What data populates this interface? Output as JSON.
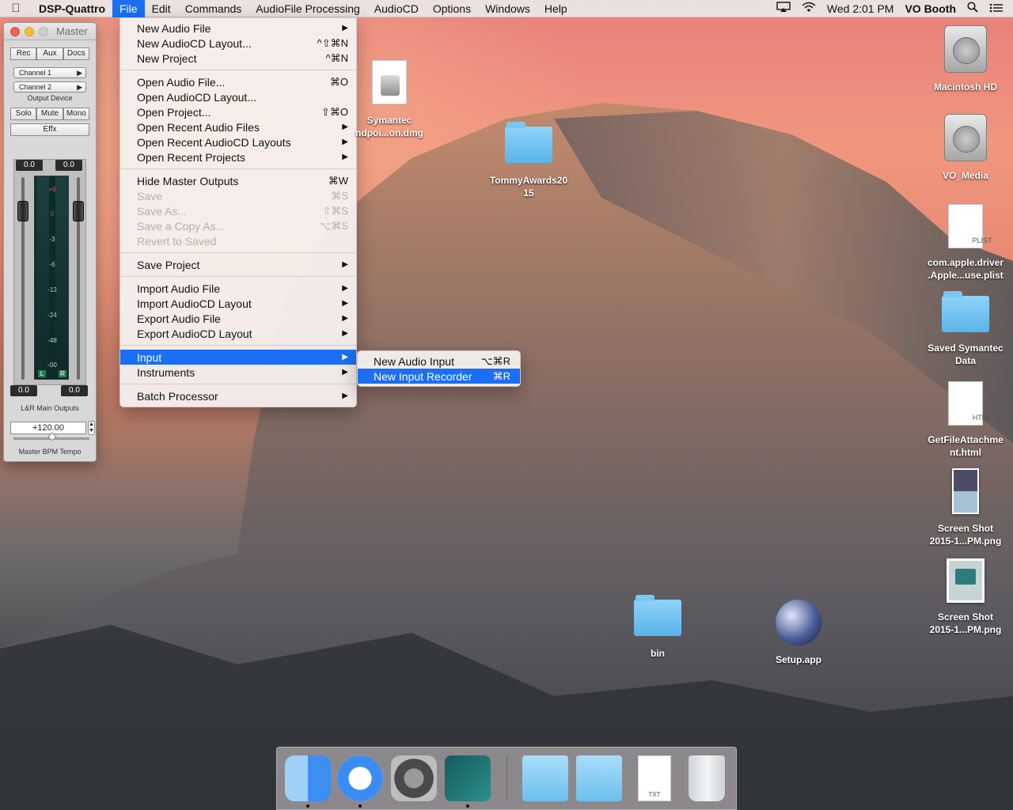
{
  "menubar": {
    "apple": "",
    "app_name": "DSP-Quattro",
    "menus": [
      "File",
      "Edit",
      "Commands",
      "AudioFile Processing",
      "AudioCD",
      "Options",
      "Windows",
      "Help"
    ],
    "clock": "Wed 2:01 PM",
    "user": "VO Booth"
  },
  "master_panel": {
    "title": "Master",
    "tabs": [
      "Rec",
      "Aux",
      "Docs"
    ],
    "channel1": "Channel  1",
    "channel2": "Channel  2",
    "output_device": "Output Device",
    "buttons": [
      "Solo",
      "Mute",
      "Mono"
    ],
    "effx": "Effx",
    "top_left_readout": "0.0",
    "top_right_readout": "0.0",
    "bottom_left_readout": "0.0",
    "bottom_right_readout": "0.0",
    "scale_ticks": [
      "+6",
      "0",
      "-3",
      "-6",
      "-12",
      "-24",
      "-48",
      "-00"
    ],
    "left_label": "L",
    "right_label": "R",
    "outputs_label": "L&R Main Outputs",
    "bpm_value": "+120.00",
    "bpm_label": "Master BPM Tempo"
  },
  "file_menu": {
    "groups": [
      [
        {
          "label": "New Audio File",
          "shortcut": "",
          "submenu": true,
          "disabled": false
        },
        {
          "label": "New AudioCD Layout...",
          "shortcut": "^⇧⌘N",
          "submenu": false,
          "disabled": false
        },
        {
          "label": "New Project",
          "shortcut": "^⌘N",
          "submenu": false,
          "disabled": false
        }
      ],
      [
        {
          "label": "Open Audio File...",
          "shortcut": "⌘O",
          "submenu": false,
          "disabled": false
        },
        {
          "label": "Open AudioCD Layout...",
          "shortcut": "",
          "submenu": false,
          "disabled": false
        },
        {
          "label": "Open Project...",
          "shortcut": "⇧⌘O",
          "submenu": false,
          "disabled": false
        },
        {
          "label": "Open Recent Audio Files",
          "shortcut": "",
          "submenu": true,
          "disabled": false
        },
        {
          "label": "Open Recent AudioCD Layouts",
          "shortcut": "",
          "submenu": true,
          "disabled": false
        },
        {
          "label": "Open Recent Projects",
          "shortcut": "",
          "submenu": true,
          "disabled": false
        }
      ],
      [
        {
          "label": "Hide Master Outputs",
          "shortcut": "⌘W",
          "submenu": false,
          "disabled": false
        },
        {
          "label": "Save",
          "shortcut": "⌘S",
          "submenu": false,
          "disabled": true
        },
        {
          "label": "Save As...",
          "shortcut": "⇧⌘S",
          "submenu": false,
          "disabled": true
        },
        {
          "label": "Save a Copy As...",
          "shortcut": "⌥⌘S",
          "submenu": false,
          "disabled": true
        },
        {
          "label": "Revert to Saved",
          "shortcut": "",
          "submenu": false,
          "disabled": true
        }
      ],
      [
        {
          "label": "Save Project",
          "shortcut": "",
          "submenu": true,
          "disabled": false
        }
      ],
      [
        {
          "label": "Import Audio File",
          "shortcut": "",
          "submenu": true,
          "disabled": false
        },
        {
          "label": "Import AudioCD Layout",
          "shortcut": "",
          "submenu": true,
          "disabled": false
        },
        {
          "label": "Export Audio File",
          "shortcut": "",
          "submenu": true,
          "disabled": false
        },
        {
          "label": "Export AudioCD Layout",
          "shortcut": "",
          "submenu": true,
          "disabled": false
        }
      ],
      [
        {
          "label": "Input",
          "shortcut": "",
          "submenu": true,
          "disabled": false,
          "highlighted": true
        },
        {
          "label": "Instruments",
          "shortcut": "",
          "submenu": true,
          "disabled": false
        }
      ],
      [
        {
          "label": "Batch Processor",
          "shortcut": "",
          "submenu": true,
          "disabled": false
        }
      ]
    ]
  },
  "input_submenu": [
    {
      "label": "New Audio Input",
      "shortcut": "⌥⌘R",
      "highlighted": false
    },
    {
      "label": "New Input Recorder",
      "shortcut": "⌘R",
      "highlighted": true
    }
  ],
  "desktop_icons": {
    "macintosh_hd": "Macintosh HD",
    "vo_media": "VO_Media",
    "plist_tag": "PLIST",
    "plist_name_1": "com.apple.driver",
    "plist_name_2": ".Apple...use.plist",
    "saved_symantec_1": "Saved Symantec",
    "saved_symantec_2": "Data",
    "html_tag": "HTML",
    "html_name_1": "GetFileAttachme",
    "html_name_2": "nt.html",
    "shot1_name_1": "Screen Shot",
    "shot1_name_2": "2015-1...PM.png",
    "shot2_name_1": "Screen Shot",
    "shot2_name_2": "2015-1...PM.png",
    "symantec_1": "Symantec",
    "symantec_2": "ndpoi...on.dmg",
    "tommy_1": "TommyAwards20",
    "tommy_2": "15",
    "bin": "bin",
    "setup": "Setup.app"
  },
  "dock": {
    "txt_tag": "TXT"
  }
}
